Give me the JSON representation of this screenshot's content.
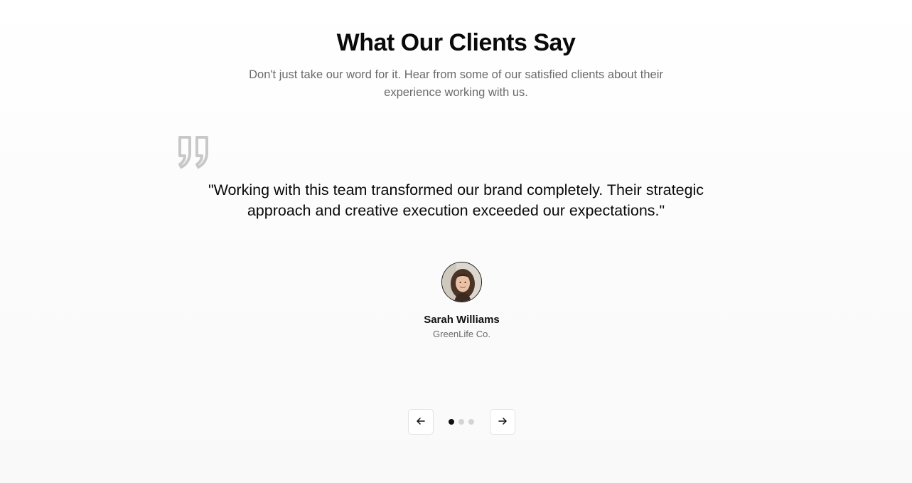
{
  "section": {
    "title": "What Our Clients Say",
    "subtitle": "Don't just take our word for it. Hear from some of our satisfied clients about their experience working with us."
  },
  "testimonial": {
    "quote_icon": "quote-mark-icon",
    "text": "\"Working with this team transformed our brand completely. Their strategic approach and creative execution exceeded our expectations.\"",
    "author_name": "Sarah Williams",
    "author_company": "GreenLife Co."
  },
  "carousel": {
    "prev_icon": "arrow-left-icon",
    "next_icon": "arrow-right-icon",
    "total_slides": 3,
    "active_slide": 1
  },
  "colors": {
    "title": "#0a0a0a",
    "muted": "#6b6b6b",
    "quote_icon": "#c8c8c8",
    "dot_active": "#111111",
    "dot_inactive": "#d4d4d4"
  }
}
